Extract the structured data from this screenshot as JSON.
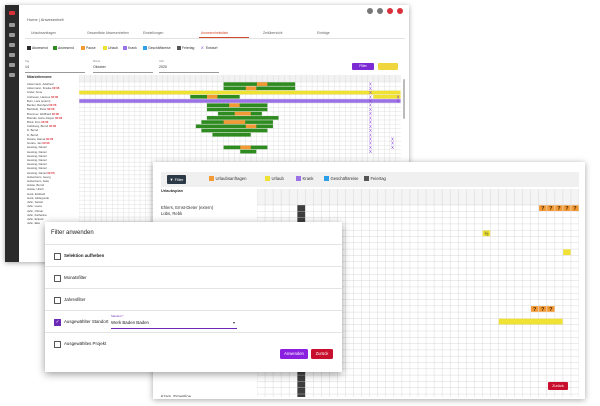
{
  "colors": {
    "abwesend": "#2b2b2b",
    "anwesend": "#2e8b1f",
    "pause": "#f39a34",
    "urlaub": "#f0e233",
    "krank": "#9b72e6",
    "geschaeftsreise": "#2d9fe6",
    "feiertag": "#555555",
    "entwurf": "#7b2fd8",
    "accent_purple": "#8b1fe0",
    "accent_red": "#c8102e",
    "fragezeichen": "#f39a34"
  },
  "back_window": {
    "breadcrumb": "Home | Anwesenheit",
    "tabs": [
      "Urlaubsanfragen",
      "Gesamtliste Abwesenheiten",
      "Einstellungen",
      "Anwesenheitsliste",
      "Zeitübersicht",
      "Einträge"
    ],
    "active_tab_index": 3,
    "legend": [
      {
        "label": "Abwesend",
        "color": "#2b2b2b",
        "icon": "square"
      },
      {
        "label": "Anwesend",
        "color": "#2e8b1f",
        "icon": "square"
      },
      {
        "label": "Pause",
        "color": "#f39a34",
        "icon": "square"
      },
      {
        "label": "Urlaub",
        "color": "#f0e233",
        "icon": "square"
      },
      {
        "label": "Krank",
        "color": "#9b72e6",
        "icon": "square"
      },
      {
        "label": "Geschäftsreise",
        "color": "#2d9fe6",
        "icon": "square"
      },
      {
        "label": "Feiertag",
        "color": "#555555",
        "icon": "square"
      },
      {
        "label": "Entwurf",
        "color": "#7b2fd8",
        "icon": "x-mark"
      }
    ],
    "filters": [
      {
        "label": "Tag",
        "value": "14"
      },
      {
        "label": "Monat",
        "value": "Oktober"
      },
      {
        "label": "Jahr",
        "value": "2020"
      }
    ],
    "filter_button": "Filter",
    "employee_header": "Mitarbeitername",
    "employees": [
      {
        "name": "Ackermann, Adelheid",
        "badge": ""
      },
      {
        "name": "Ackermann, Frauke",
        "badge": "02:06"
      },
      {
        "name": "Ander, Anne",
        "badge": ""
      },
      {
        "name": "Andresen, Hannes",
        "badge": "02:06"
      },
      {
        "name": "Born, Lara (extern)",
        "badge": ""
      },
      {
        "name": "Becker, Reinhard",
        "badge": "02:06"
      },
      {
        "name": "Berkbeth, Peter",
        "badge": "02:06"
      },
      {
        "name": "Brummer, Wolfhard",
        "badge": "02:06"
      },
      {
        "name": "Brandts, Hans-Jürgen",
        "badge": "02:06"
      },
      {
        "name": "Brink, Finn",
        "badge": "02:06"
      },
      {
        "name": "Carlsberg, Bernd",
        "badge": "02:06"
      },
      {
        "name": "D, Bernd",
        "badge": ""
      },
      {
        "name": "D, Bernd",
        "badge": ""
      },
      {
        "name": "Dorato, Hanna",
        "badge": "02:06"
      },
      {
        "name": "Gorato, Jan",
        "badge": "02:06"
      },
      {
        "name": "Hessing, Daniel",
        "badge": ""
      },
      {
        "name": "Hessing, Daniel",
        "badge": ""
      },
      {
        "name": "Hessing, Daniel",
        "badge": ""
      },
      {
        "name": "Hessing, Daniel",
        "badge": ""
      },
      {
        "name": "Hessing, Daniel",
        "badge": ""
      },
      {
        "name": "Hessing, Daniel",
        "badge": ""
      },
      {
        "name": "Hessing, Daniel",
        "badge": "02:06"
      },
      {
        "name": "Hohenheim, Georg",
        "badge": ""
      },
      {
        "name": "Hohenheim, Anke",
        "badge": ""
      },
      {
        "name": "Holste, Bernd",
        "badge": ""
      },
      {
        "name": "Holste, Ulrich",
        "badge": ""
      },
      {
        "name": "Huck, Eckhard",
        "badge": ""
      },
      {
        "name": "Huck, Hildegunde",
        "badge": ""
      },
      {
        "name": "Jahn, Sarwin",
        "badge": ""
      },
      {
        "name": "Jahn, Laura",
        "badge": ""
      },
      {
        "name": "Jahn, Ottmar",
        "badge": ""
      },
      {
        "name": "Jahn, Katharina",
        "badge": ""
      },
      {
        "name": "Jahn, Eckard",
        "badge": ""
      },
      {
        "name": "Jahn, Elke",
        "badge": ""
      }
    ],
    "grid_cols": 58,
    "grid_rows": 42,
    "row_spans": [
      {
        "row": 1,
        "kind": "anwesend",
        "from": 26,
        "to": 38
      },
      {
        "row": 1,
        "kind": "pause",
        "from": 32,
        "to": 33
      },
      {
        "row": 2,
        "kind": "anwesend",
        "from": 26,
        "to": 38
      },
      {
        "row": 2,
        "kind": "pause",
        "from": 30,
        "to": 31
      },
      {
        "row": 3,
        "kind": "urlaub",
        "from": 0,
        "to": 57
      },
      {
        "row": 4,
        "kind": "anwesend",
        "from": 20,
        "to": 28
      },
      {
        "row": 4,
        "kind": "pause",
        "from": 23,
        "to": 24
      },
      {
        "row": 4,
        "kind": "urlaub",
        "from": 53,
        "to": 57
      },
      {
        "row": 5,
        "kind": "krank",
        "from": 0,
        "to": 57
      },
      {
        "row": 6,
        "kind": "anwesend",
        "from": 23,
        "to": 33
      },
      {
        "row": 6,
        "kind": "pause",
        "from": 27,
        "to": 28
      },
      {
        "row": 7,
        "kind": "anwesend",
        "from": 23,
        "to": 33
      },
      {
        "row": 8,
        "kind": "anwesend",
        "from": 25,
        "to": 32
      },
      {
        "row": 8,
        "kind": "pause",
        "from": 28,
        "to": 30
      },
      {
        "row": 9,
        "kind": "anwesend",
        "from": 23,
        "to": 35
      },
      {
        "row": 10,
        "kind": "anwesend",
        "from": 22,
        "to": 34
      },
      {
        "row": 10,
        "kind": "pause",
        "from": 26,
        "to": 29
      },
      {
        "row": 11,
        "kind": "anwesend",
        "from": 21,
        "to": 34
      },
      {
        "row": 11,
        "kind": "pause",
        "from": 30,
        "to": 31
      },
      {
        "row": 12,
        "kind": "anwesend",
        "from": 22,
        "to": 33
      },
      {
        "row": 13,
        "kind": "anwesend",
        "from": 24,
        "to": 30
      },
      {
        "row": 16,
        "kind": "anwesend",
        "from": 26,
        "to": 33
      },
      {
        "row": 16,
        "kind": "pause",
        "from": 29,
        "to": 30
      },
      {
        "row": 17,
        "kind": "anwesend",
        "from": 29,
        "to": 31
      }
    ],
    "x_marks": [
      [
        1,
        52
      ],
      [
        2,
        52
      ],
      [
        3,
        52
      ],
      [
        4,
        52
      ],
      [
        5,
        52
      ],
      [
        6,
        52
      ],
      [
        7,
        52
      ],
      [
        8,
        52
      ],
      [
        9,
        52
      ],
      [
        10,
        52
      ],
      [
        11,
        52
      ],
      [
        12,
        52
      ],
      [
        13,
        52
      ],
      [
        14,
        52
      ],
      [
        15,
        52
      ],
      [
        16,
        52
      ],
      [
        17,
        52
      ],
      [
        14,
        56
      ],
      [
        15,
        56
      ],
      [
        16,
        56
      ],
      [
        4,
        57
      ],
      [
        5,
        57
      ]
    ]
  },
  "front_window": {
    "filter_button": "Filter",
    "legend": [
      {
        "label": "Urlaubsanfragen",
        "color": "#f39a34"
      },
      {
        "label": "Urlaub",
        "color": "#f0e233"
      },
      {
        "label": "Krank",
        "color": "#9b72e6"
      },
      {
        "label": "Geschäftsreise",
        "color": "#2d9fe6"
      },
      {
        "label": "Feiertag",
        "color": "#555555"
      }
    ],
    "header": "Urlaubsplan",
    "employees": [
      "Ehlers, Ernst-Dieter (extern)",
      "Lübs, Rebk",
      "",
      "",
      "",
      "",
      "",
      "",
      "",
      "",
      "",
      "",
      "",
      "",
      "",
      "",
      "",
      "",
      "",
      "",
      "",
      "",
      "",
      "",
      "",
      "",
      "",
      "",
      "",
      "",
      "Kram, Ernestine"
    ],
    "grid_cols": 40,
    "grid_rows": 34,
    "question_marks": [
      [
        1,
        35
      ],
      [
        1,
        36
      ],
      [
        1,
        37
      ],
      [
        1,
        38
      ],
      [
        1,
        39
      ],
      [
        17,
        34
      ],
      [
        17,
        35
      ],
      [
        17,
        36
      ]
    ],
    "half_marks": [
      [
        5,
        28
      ]
    ],
    "yellow_cells": [
      [
        8,
        38
      ]
    ],
    "yellow_spans": [
      {
        "row": 19,
        "from": 30,
        "to": 37
      }
    ],
    "holiday_col": 5,
    "question_mark": "?",
    "half_mark": "½",
    "close_button": "Zurück"
  },
  "modal": {
    "title": "Filter anwenden",
    "rows": [
      {
        "label": "Selektion aufheben",
        "checked": false,
        "bold": true
      },
      {
        "label": "Monatsfilter",
        "checked": false,
        "bold": false
      },
      {
        "label": "Jahresfilter",
        "checked": false,
        "bold": false
      },
      {
        "label": "Ausgewählter Standort",
        "checked": true,
        "bold": false
      },
      {
        "label": "Ausgewähltes Projekt",
        "checked": false,
        "bold": false
      }
    ],
    "location_field": {
      "label": "Standort *",
      "value": "Werk Baden Baden"
    },
    "apply_button": "Anwenden",
    "back_button": "Zurück"
  }
}
